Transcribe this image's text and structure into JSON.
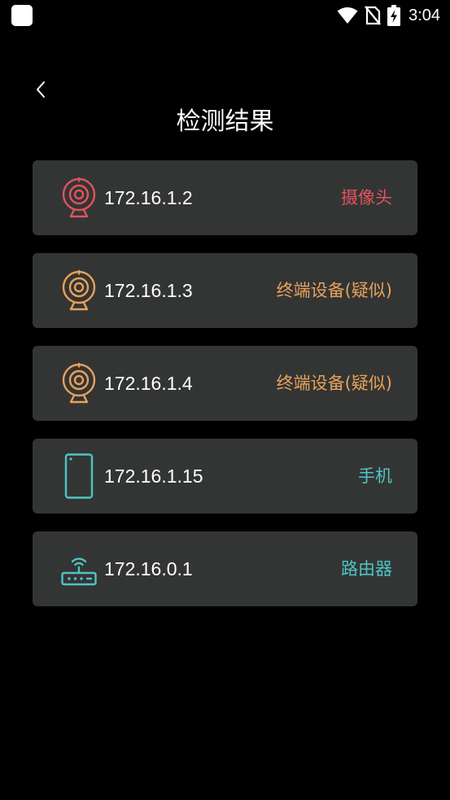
{
  "status_bar": {
    "time": "3:04"
  },
  "header": {
    "title": "检测结果"
  },
  "colors": {
    "background": "#000000",
    "card": "#333534",
    "camera_red": "#e0535d",
    "camera_orange": "#e8a15a",
    "device_teal": "#4fc4c6"
  },
  "devices": [
    {
      "ip": "172.16.1.2",
      "type": "摄像头",
      "icon": "webcam-icon",
      "color": "#e0535d"
    },
    {
      "ip": "172.16.1.3",
      "type": "终端设备(疑似)",
      "icon": "webcam-icon",
      "color": "#e8a15a"
    },
    {
      "ip": "172.16.1.4",
      "type": "终端设备(疑似)",
      "icon": "webcam-icon",
      "color": "#e8a15a"
    },
    {
      "ip": "172.16.1.15",
      "type": "手机",
      "icon": "phone-icon",
      "color": "#4fc4c6"
    },
    {
      "ip": "172.16.0.1",
      "type": "路由器",
      "icon": "router-icon",
      "color": "#4fc4c6"
    }
  ]
}
